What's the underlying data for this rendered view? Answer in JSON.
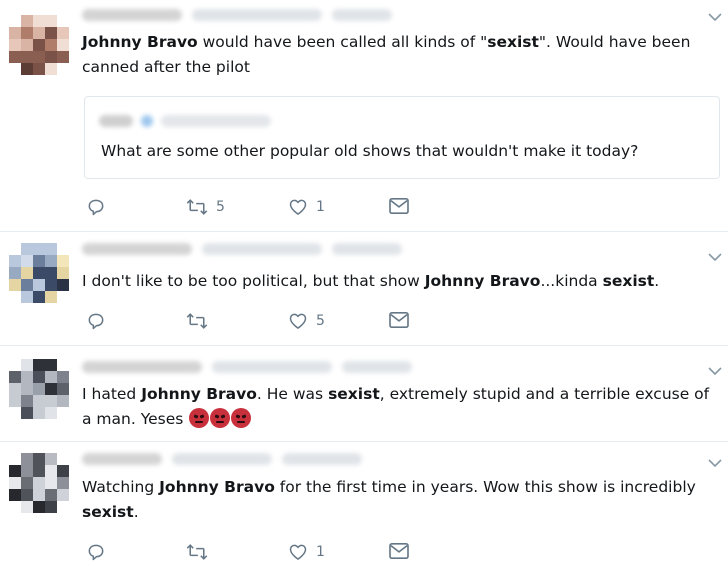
{
  "tweets": [
    {
      "text_parts": [
        {
          "t": "Johnny Bravo",
          "b": true
        },
        {
          "t": " would have been called all kinds of \"",
          "b": false
        },
        {
          "t": "sexist",
          "b": true
        },
        {
          "t": "\". Would have been canned after the pilot",
          "b": false
        }
      ],
      "quote": {
        "text": "What are some other popular old shows that wouldn't make it today?"
      },
      "retweet_count": "5",
      "like_count": "1"
    },
    {
      "text_parts": [
        {
          "t": "I don't like to be too political, but that show ",
          "b": false
        },
        {
          "t": "Johnny Bravo",
          "b": true
        },
        {
          "t": "...kinda ",
          "b": false
        },
        {
          "t": "sexist",
          "b": true
        },
        {
          "t": ".",
          "b": false
        }
      ],
      "retweet_count": "",
      "like_count": "5"
    },
    {
      "text_parts": [
        {
          "t": "I hated ",
          "b": false
        },
        {
          "t": "Johnny Bravo",
          "b": true
        },
        {
          "t": ". He was ",
          "b": false
        },
        {
          "t": "sexist",
          "b": true
        },
        {
          "t": ", extremely stupid and a terrible excuse of a man. Yeses ",
          "b": false
        }
      ],
      "emoji_count": 3,
      "emoji_icon": "angry-face-icon"
    },
    {
      "text_parts": [
        {
          "t": "Watching ",
          "b": false
        },
        {
          "t": "Johnny Bravo",
          "b": true
        },
        {
          "t": " for the first time in years. Wow this show is incredibly ",
          "b": false
        },
        {
          "t": "sexist",
          "b": true
        },
        {
          "t": ".",
          "b": false
        }
      ],
      "retweet_count": "",
      "like_count": "1"
    }
  ],
  "icons": {
    "reply": "reply-icon",
    "retweet": "retweet-icon",
    "like": "heart-icon",
    "dm": "envelope-icon",
    "menu": "chevron-down-icon"
  },
  "colors": {
    "text": "#14171a",
    "action_gray": "#657786",
    "border": "#e6ecf0"
  }
}
